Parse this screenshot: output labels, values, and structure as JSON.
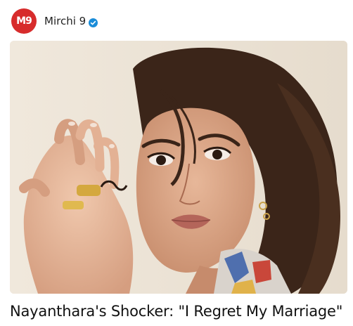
{
  "source": {
    "logo_text": "M9",
    "name": "Mirchi 9",
    "verified_icon": "verified-badge-icon",
    "brand_color": "#d72c2c",
    "verified_color": "#1a8cd8"
  },
  "card": {
    "image_icon": "portrait-photo",
    "headline": "Nayanthara's Shocker: \"I Regret My Marriage\""
  }
}
